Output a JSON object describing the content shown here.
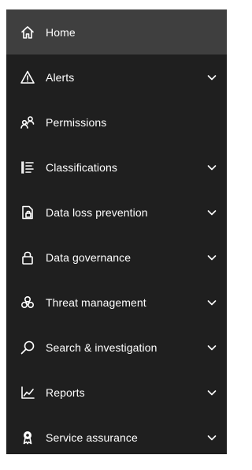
{
  "nav": {
    "items": [
      {
        "label": "Home",
        "icon": "home-icon",
        "active": true,
        "expandable": false
      },
      {
        "label": "Alerts",
        "icon": "warning-icon",
        "active": false,
        "expandable": true
      },
      {
        "label": "Permissions",
        "icon": "people-icon",
        "active": false,
        "expandable": false
      },
      {
        "label": "Classifications",
        "icon": "list-icon",
        "active": false,
        "expandable": true
      },
      {
        "label": "Data loss prevention",
        "icon": "document-lock-icon",
        "active": false,
        "expandable": true
      },
      {
        "label": "Data governance",
        "icon": "lock-icon",
        "active": false,
        "expandable": true
      },
      {
        "label": "Threat management",
        "icon": "biohazard-icon",
        "active": false,
        "expandable": true
      },
      {
        "label": "Search & investigation",
        "icon": "search-icon",
        "active": false,
        "expandable": true
      },
      {
        "label": "Reports",
        "icon": "chart-icon",
        "active": false,
        "expandable": true
      },
      {
        "label": "Service assurance",
        "icon": "ribbon-icon",
        "active": false,
        "expandable": true
      }
    ]
  },
  "colors": {
    "nav_background": "#1f1f1f",
    "active_background": "#3f3f3f",
    "text": "#ffffff"
  }
}
